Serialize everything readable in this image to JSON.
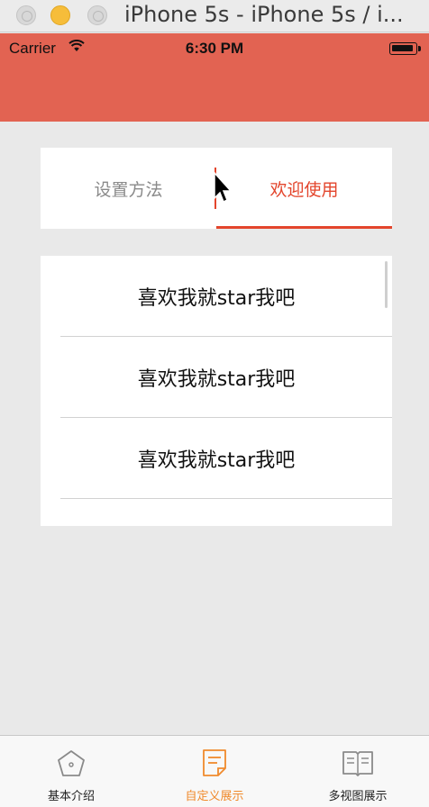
{
  "window": {
    "title": "iPhone 5s - iPhone 5s / i..."
  },
  "status_bar": {
    "carrier": "Carrier",
    "time": "6:30 PM"
  },
  "segment": {
    "tabs": [
      {
        "label": "设置方法",
        "selected": false
      },
      {
        "label": "欢迎使用",
        "selected": true
      }
    ]
  },
  "list": {
    "rows": [
      "喜欢我就star我吧",
      "喜欢我就star我吧",
      "喜欢我就star我吧"
    ]
  },
  "tab_bar": {
    "items": [
      {
        "label": "基本介绍",
        "icon": "home-pentagon-icon",
        "active": false
      },
      {
        "label": "自定义展示",
        "icon": "document-icon",
        "active": true
      },
      {
        "label": "多视图展示",
        "icon": "book-icon",
        "active": false
      }
    ]
  },
  "colors": {
    "accent": "#e3452c",
    "navbar": "#e26352",
    "tab_active": "#f08a2c"
  }
}
